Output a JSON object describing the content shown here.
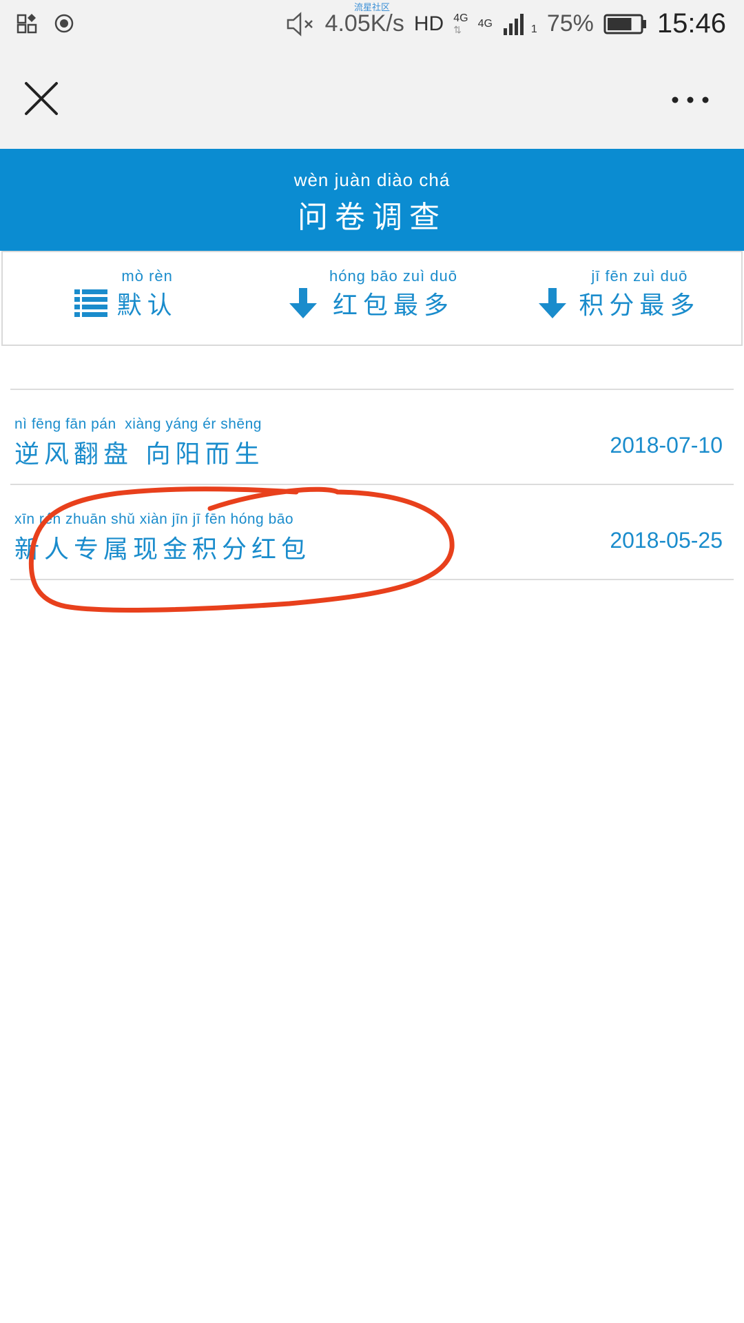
{
  "status_bar": {
    "carrier_label": "流星社区",
    "net_speed": "4.05K/s",
    "hd_label": "HD",
    "network_label": "4G",
    "network_label_2": "4G",
    "sim_slot": "1",
    "battery_percent": "75%",
    "battery_level": 0.75,
    "time": "15:46"
  },
  "nav": {
    "close_icon": "close-icon",
    "more_icon": "more-icon"
  },
  "header": {
    "title_pinyin": "wèn juàn diào chá",
    "title": "问卷调查",
    "bg_color": "#0b8cd1"
  },
  "tabs": [
    {
      "pinyin": "mò rèn",
      "label": "默认",
      "icon": "list-icon"
    },
    {
      "pinyin": "hóng bāo zuì duō",
      "label": "红包最多",
      "icon": "arrow-down-icon"
    },
    {
      "pinyin": "jī fēn zuì duō",
      "label": "积分最多",
      "icon": "arrow-down-icon"
    }
  ],
  "surveys": [
    {
      "pinyin": "nì fēng fān pán  xiàng yáng ér shēng",
      "title": "逆风翻盘 向阳而生",
      "date": "2018-07-10"
    },
    {
      "pinyin": "xīn rén zhuān shǔ xiàn jīn jī fēn hóng bāo",
      "title": "新人专属现金积分红包",
      "date": "2018-05-25"
    }
  ],
  "accent_color": "#1a8ccc",
  "annotation_color": "#e8401c"
}
